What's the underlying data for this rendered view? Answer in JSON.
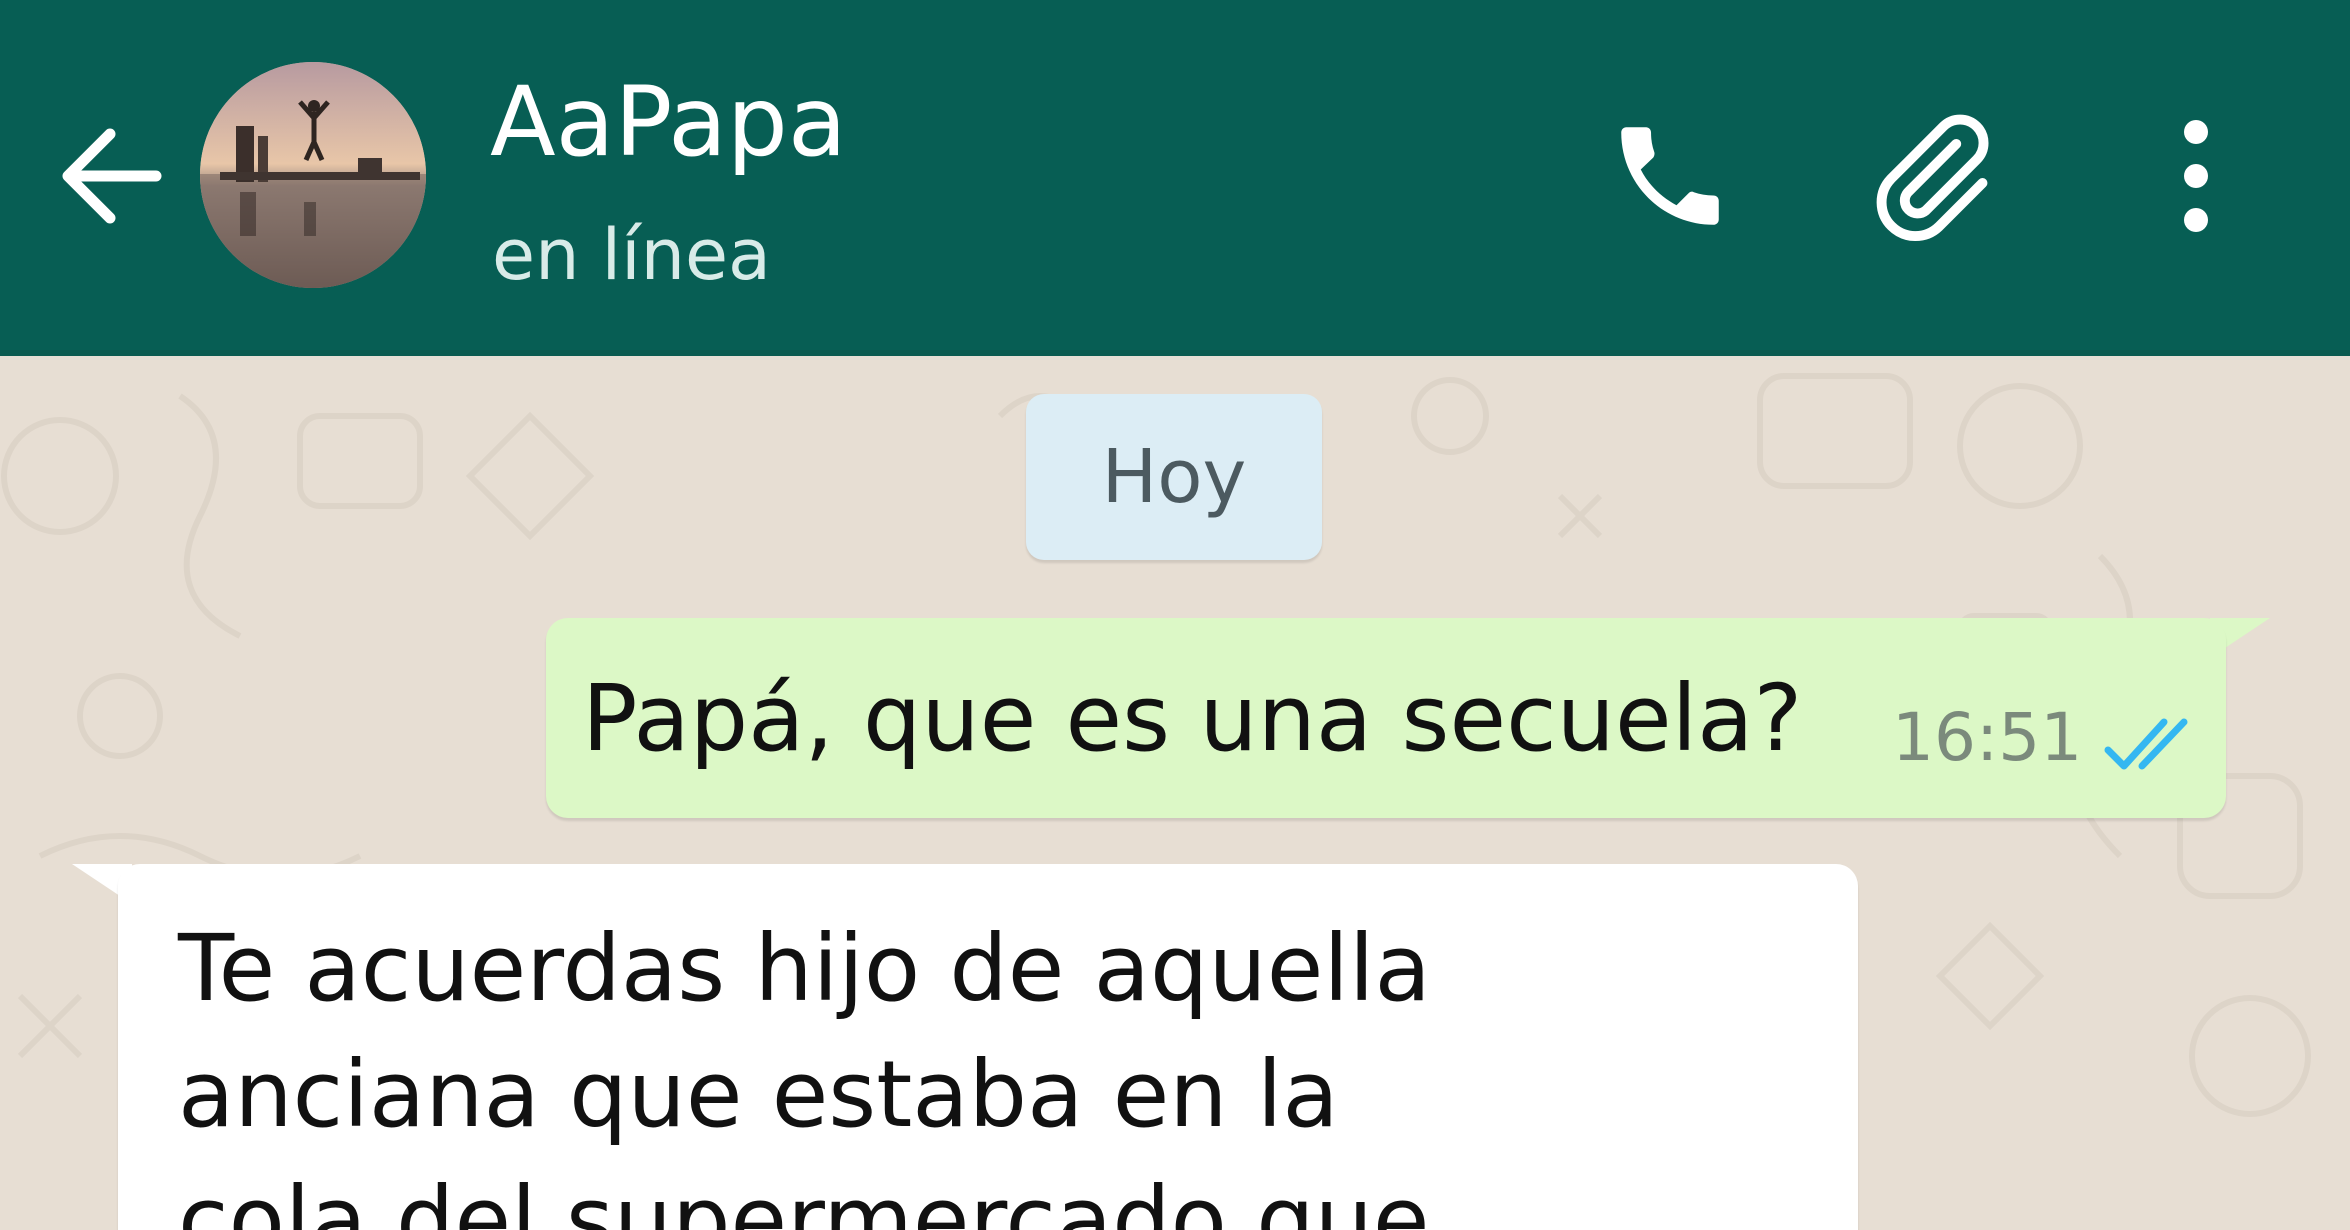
{
  "header": {
    "contact_name": "AaPapa",
    "status": "en línea",
    "back_icon": "arrow-left-icon",
    "call_icon": "phone-icon",
    "attach_icon": "paperclip-icon",
    "menu_icon": "more-vertical-icon",
    "background_color": "#075e54"
  },
  "chat": {
    "date_separator": "Hoy",
    "messages": [
      {
        "direction": "outgoing",
        "text": "Papá, que es una secuela?",
        "time": "16:51",
        "status_icon": "double-check-icon",
        "bubble_color": "#dcf8c6",
        "tick_color": "#34b7f1"
      },
      {
        "direction": "incoming",
        "lines": [
          "Te acuerdas hijo de aquella",
          "anciana que estaba en la",
          "cola del supermercado que"
        ],
        "bubble_color": "#ffffff"
      }
    ],
    "wallpaper_color": "#e7ded3"
  }
}
